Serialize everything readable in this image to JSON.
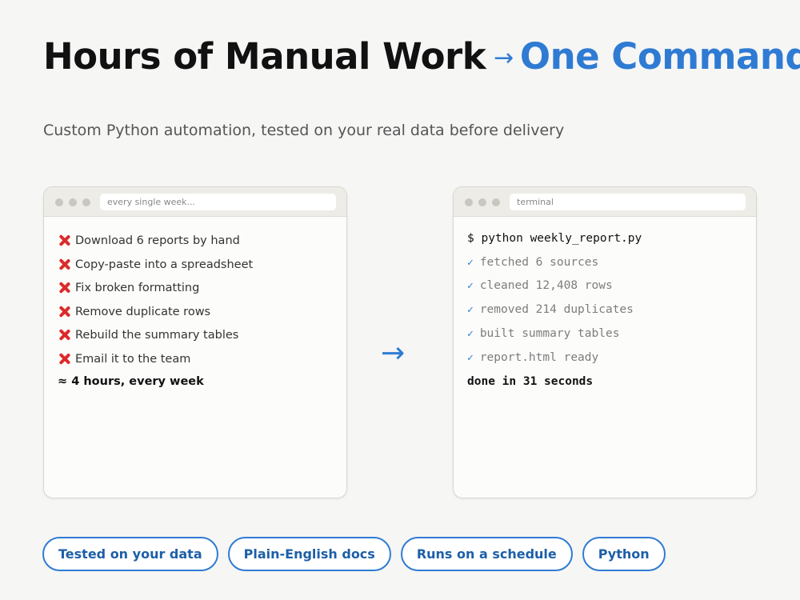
{
  "header": {
    "title_main": "Hours of Manual Work",
    "arrow": "→",
    "title_accent": "One Command",
    "subtitle": "Custom Python automation, tested on your real data before delivery"
  },
  "left_window": {
    "url": "every single week...",
    "items": [
      "Download 6 reports by hand",
      "Copy-paste into a spreadsheet",
      "Fix broken formatting",
      "Remove duplicate rows",
      "Rebuild the summary tables",
      "Email it to the team"
    ],
    "item_icon": "cross-mark-icon",
    "total": "≈ 4 hours, every week"
  },
  "middle_arrow": "→",
  "right_window": {
    "url": "terminal",
    "command": "$ python weekly_report.py",
    "check": "✓",
    "steps": [
      "fetched 6 sources",
      "cleaned 12,408 rows",
      "removed 214 duplicates",
      "built summary tables",
      "report.html ready"
    ],
    "done": "done in 31 seconds"
  },
  "pills": [
    "Tested on your data",
    "Plain-English docs",
    "Runs on a schedule",
    "Python"
  ],
  "colors": {
    "accent": "#2f7bd3",
    "error": "#dc2a2a",
    "background": "#f6f6f5"
  }
}
